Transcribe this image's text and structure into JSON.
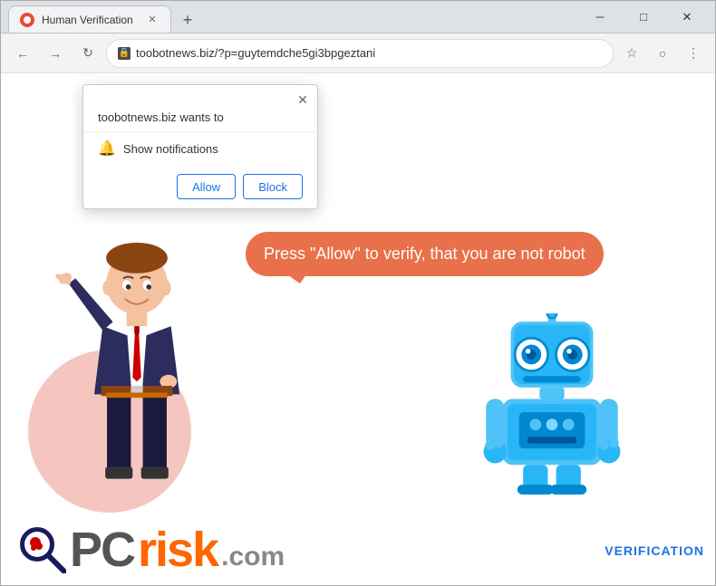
{
  "window": {
    "title": "Human Verification",
    "close_label": "✕",
    "minimize_label": "─",
    "maximize_label": "□"
  },
  "tab": {
    "title": "Human Verification",
    "new_tab_icon": "+"
  },
  "nav": {
    "back_icon": "←",
    "forward_icon": "→",
    "reload_icon": "↻",
    "url": "toobotnews.biz/?p=guytemdche5gi3bpgeztani",
    "star_icon": "☆",
    "profile_icon": "○",
    "menu_icon": "⋮"
  },
  "popup": {
    "title": "toobotnews.biz wants to",
    "close_icon": "✕",
    "notification_label": "Show notifications",
    "allow_button": "Allow",
    "block_button": "Block"
  },
  "page": {
    "speech_bubble": "Press \"Allow\" to verify, that you are not robot",
    "verification_badge": "VERIFICATION"
  },
  "pcrisk": {
    "pc_text": "PC",
    "risk_text": "risk",
    "com_text": ".com"
  }
}
